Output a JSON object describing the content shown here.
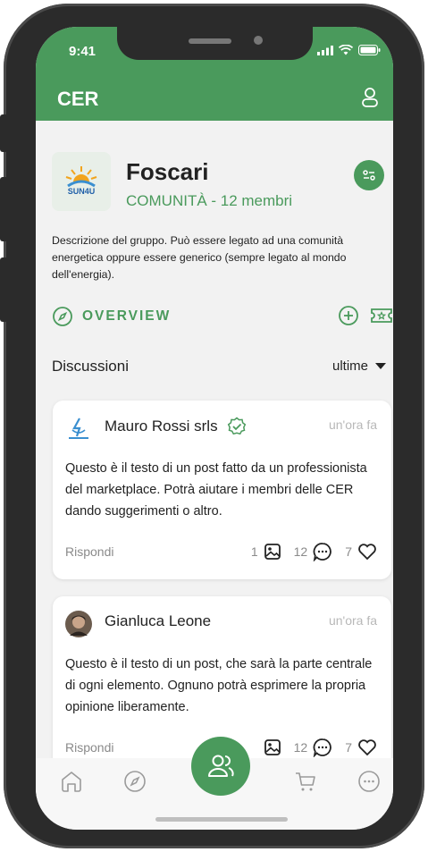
{
  "status_bar": {
    "time": "9:41"
  },
  "header": {
    "title": "CER",
    "user_icon": "user-icon"
  },
  "group": {
    "name": "Foscari",
    "subtitle": "COMUNITÀ - 12 membri",
    "logo_text": "SUN4U",
    "description": "Descrizione del gruppo. Può essere legato ad una comunità energetica oppure essere generico (sempre legato al mondo dell'energia)."
  },
  "overview": {
    "label": "OVERVIEW"
  },
  "discussions": {
    "title": "Discussioni",
    "sort_label": "ultime"
  },
  "posts": [
    {
      "author": "Mauro Rossi srls",
      "verified": true,
      "time": "un'ora fa",
      "body": "Questo è il testo di un post fatto da un professionista del marketplace. Potrà aiutare i membri delle CER dando suggerimenti o altro.",
      "reply_label": "Rispondi",
      "images": "1",
      "comments": "12",
      "likes": "7"
    },
    {
      "author": "Gianluca Leone",
      "verified": false,
      "time": "un'ora fa",
      "body": "Questo è il testo di un post, che sarà la parte centrale di ogni elemento. Ognuno potrà esprimere la propria opinione liberamente.",
      "reply_label": "Rispondi",
      "images": "",
      "comments": "12",
      "likes": "7"
    }
  ],
  "bottom_nav": [
    "home-icon",
    "compass-icon",
    "community-icon",
    "cart-icon",
    "more-icon"
  ],
  "colors": {
    "accent": "#4a9a5c",
    "text": "#222222",
    "muted": "#8a8a8a"
  }
}
